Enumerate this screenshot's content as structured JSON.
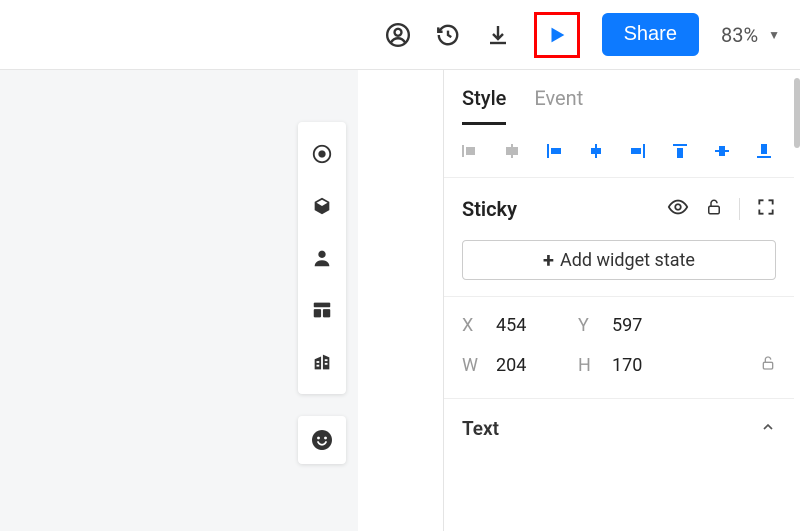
{
  "topbar": {
    "share_label": "Share",
    "zoom": "83%"
  },
  "tabs": {
    "style": "Style",
    "event": "Event",
    "active": "style"
  },
  "widget": {
    "name": "Sticky",
    "add_state_label": "Add widget state"
  },
  "geometry": {
    "x_label": "X",
    "x": "454",
    "y_label": "Y",
    "y": "597",
    "w_label": "W",
    "w": "204",
    "h_label": "H",
    "h": "170"
  },
  "sections": {
    "text": "Text"
  }
}
